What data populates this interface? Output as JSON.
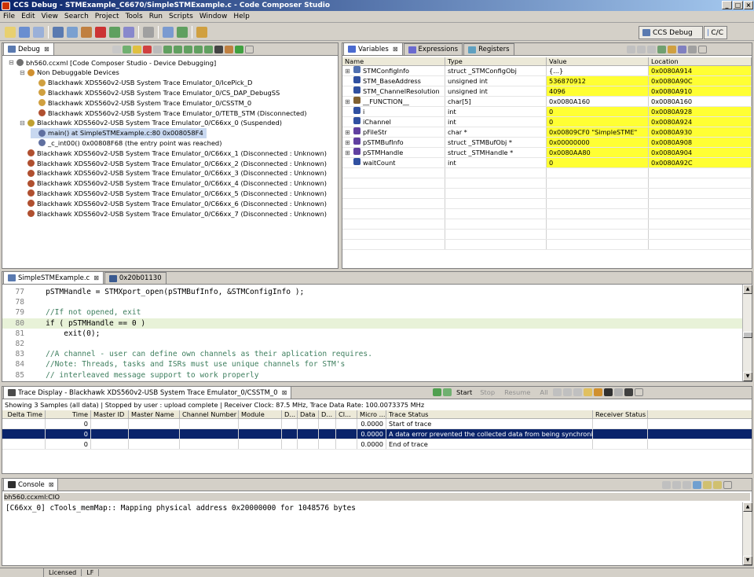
{
  "window": {
    "title": "CCS Debug - STMExample_C6670/SimpleSTMExample.c - Code Composer Studio"
  },
  "menu": [
    "File",
    "Edit",
    "View",
    "Search",
    "Project",
    "Tools",
    "Run",
    "Scripts",
    "Window",
    "Help"
  ],
  "perspective": {
    "active": "CCS Debug",
    "other": "C/C"
  },
  "debug": {
    "tab": "Debug",
    "tree": [
      {
        "indent": 0,
        "icon": "target-config-icon",
        "label": "bh560.ccxml [Code Composer Studio - Device Debugging]",
        "sel": false
      },
      {
        "indent": 1,
        "icon": "devices-icon",
        "label": "Non Debuggable Devices",
        "sel": false
      },
      {
        "indent": 2,
        "icon": "device-icon",
        "label": "Blackhawk XDS560v2-USB System Trace Emulator_0/IcePick_D",
        "sel": false
      },
      {
        "indent": 2,
        "icon": "device-icon",
        "label": "Blackhawk XDS560v2-USB System Trace Emulator_0/CS_DAP_DebugSS",
        "sel": false
      },
      {
        "indent": 2,
        "icon": "device-icon",
        "label": "Blackhawk XDS560v2-USB System Trace Emulator_0/CSSTM_0",
        "sel": false
      },
      {
        "indent": 2,
        "icon": "disconnected-icon",
        "label": "Blackhawk XDS560v2-USB System Trace Emulator_0/TETB_STM  (Disconnected)",
        "sel": false
      },
      {
        "indent": 1,
        "icon": "suspended-core-icon",
        "label": "Blackhawk XDS560v2-USB System Trace Emulator_0/C66xx_0 (Suspended)",
        "sel": false
      },
      {
        "indent": 2,
        "icon": "stack-frame-icon",
        "label": "main() at SimpleSTMExample.c:80 0x008058F4",
        "sel": true
      },
      {
        "indent": 2,
        "icon": "stack-frame-icon",
        "label": "_c_int00() 0x00808F68  (the entry point was reached)",
        "sel": false
      },
      {
        "indent": 1,
        "icon": "disconnected-icon",
        "label": "Blackhawk XDS560v2-USB System Trace Emulator_0/C66xx_1 (Disconnected : Unknown)",
        "sel": false
      },
      {
        "indent": 1,
        "icon": "disconnected-icon",
        "label": "Blackhawk XDS560v2-USB System Trace Emulator_0/C66xx_2 (Disconnected : Unknown)",
        "sel": false
      },
      {
        "indent": 1,
        "icon": "disconnected-icon",
        "label": "Blackhawk XDS560v2-USB System Trace Emulator_0/C66xx_3 (Disconnected : Unknown)",
        "sel": false
      },
      {
        "indent": 1,
        "icon": "disconnected-icon",
        "label": "Blackhawk XDS560v2-USB System Trace Emulator_0/C66xx_4 (Disconnected : Unknown)",
        "sel": false
      },
      {
        "indent": 1,
        "icon": "disconnected-icon",
        "label": "Blackhawk XDS560v2-USB System Trace Emulator_0/C66xx_5 (Disconnected : Unknown)",
        "sel": false
      },
      {
        "indent": 1,
        "icon": "disconnected-icon",
        "label": "Blackhawk XDS560v2-USB System Trace Emulator_0/C66xx_6 (Disconnected : Unknown)",
        "sel": false
      },
      {
        "indent": 1,
        "icon": "disconnected-icon",
        "label": "Blackhawk XDS560v2-USB System Trace Emulator_0/C66xx_7 (Disconnected : Unknown)",
        "sel": false
      }
    ]
  },
  "variables": {
    "tabs": [
      "Variables",
      "Expressions",
      "Registers"
    ],
    "columns": [
      "Name",
      "Type",
      "Value",
      "Location"
    ],
    "rows": [
      {
        "expand": "+",
        "icon": "struct-icon",
        "name": "STMConfigInfo",
        "type": "struct _STMConfigObj",
        "value": "{...}",
        "location": "0x0080A914",
        "yv": false,
        "yl": true
      },
      {
        "expand": "",
        "icon": "variable-icon",
        "name": "STM_BaseAddress",
        "type": "unsigned int",
        "value": "536870912",
        "location": "0x0080A90C",
        "yv": true,
        "yl": true
      },
      {
        "expand": "",
        "icon": "variable-icon",
        "name": "STM_ChannelResolution",
        "type": "unsigned int",
        "value": "4096",
        "location": "0x0080A910",
        "yv": true,
        "yl": true
      },
      {
        "expand": "+",
        "icon": "array-icon",
        "name": "__FUNCTION__",
        "type": "char[5]",
        "value": "0x0080A160",
        "location": "0x0080A160",
        "yv": false,
        "yl": false
      },
      {
        "expand": "",
        "icon": "variable-icon",
        "name": "i",
        "type": "int",
        "value": "0",
        "location": "0x0080A928",
        "yv": true,
        "yl": true
      },
      {
        "expand": "",
        "icon": "variable-icon",
        "name": "iChannel",
        "type": "int",
        "value": "0",
        "location": "0x0080A924",
        "yv": true,
        "yl": true
      },
      {
        "expand": "+",
        "icon": "pointer-icon",
        "name": "pFileStr",
        "type": "char *",
        "value": "0x00809CF0 \"SimpleSTME\"",
        "location": "0x0080A930",
        "yv": true,
        "yl": true
      },
      {
        "expand": "+",
        "icon": "pointer-icon",
        "name": "pSTMBufInfo",
        "type": "struct _STMBufObj *",
        "value": "0x00000000",
        "location": "0x0080A908",
        "yv": true,
        "yl": true
      },
      {
        "expand": "+",
        "icon": "pointer-icon",
        "name": "pSTMHandle",
        "type": "struct _STMHandle *",
        "value": "0x0080AA80",
        "location": "0x0080A904",
        "yv": true,
        "yl": true
      },
      {
        "expand": "",
        "icon": "variable-icon",
        "name": "waitCount",
        "type": "int",
        "value": "0",
        "location": "0x0080A92C",
        "yv": true,
        "yl": true
      }
    ]
  },
  "editor": {
    "tabs": [
      "SimpleSTMExample.c",
      "0x20b01130"
    ],
    "lines": [
      {
        "n": "77",
        "text": "    pSTMHandle = STMXport_open(pSTMBufInfo, &STMConfigInfo );",
        "kind": "code",
        "hl": false
      },
      {
        "n": "78",
        "text": "",
        "kind": "code",
        "hl": false
      },
      {
        "n": "79",
        "text": "    //If not opened, exit",
        "kind": "cmt",
        "hl": false
      },
      {
        "n": "80",
        "text": "    if ( pSTMHandle == 0 )",
        "kind": "code",
        "hl": true
      },
      {
        "n": "81",
        "text": "        exit(0);",
        "kind": "code",
        "hl": false
      },
      {
        "n": "82",
        "text": "",
        "kind": "code",
        "hl": false
      },
      {
        "n": "83",
        "text": "    //A channel - user can define own channels as their aplication requires.",
        "kind": "cmt",
        "hl": false
      },
      {
        "n": "84",
        "text": "    //Note: Threads, tasks and ISRs must use unique channels for STM's",
        "kind": "cmt",
        "hl": false
      },
      {
        "n": "85",
        "text": "    // interleaved message support to work properly",
        "kind": "cmt",
        "hl": false
      }
    ]
  },
  "trace": {
    "tab": "Trace Display - Blackhawk XDS560v2-USB System Trace Emulator_0/CSSTM_0",
    "toolbar": {
      "start": "Start",
      "stop": "Stop",
      "resume": "Resume",
      "all": "All"
    },
    "status": "Showing 3 Samples (all data)  |  Stopped by user : upload complete  |  Receiver Clock: 87.5 MHz, Trace Data Rate: 100.0073375 MHz",
    "columns": [
      "Delta Time",
      "Time",
      "Master ID",
      "Master Name",
      "Channel Number",
      "Module",
      "D...",
      "Data",
      "D...",
      "Cl...",
      "Micro ...",
      "Trace Status",
      "Receiver Status"
    ],
    "rows": [
      {
        "cells": [
          "",
          "0",
          "",
          "",
          "",
          "",
          "",
          "",
          "",
          "",
          "0.0000",
          "Start of trace",
          ""
        ],
        "sel": false
      },
      {
        "cells": [
          "",
          "0",
          "",
          "",
          "",
          "",
          "",
          "",
          "",
          "",
          "0.0000",
          "A data error prevented the collected data from being synchronized.",
          ""
        ],
        "sel": true
      },
      {
        "cells": [
          "",
          "0",
          "",
          "",
          "",
          "",
          "",
          "",
          "",
          "",
          "0.0000",
          "End of trace",
          ""
        ],
        "sel": false
      }
    ]
  },
  "console": {
    "tab": "Console",
    "subtitle": "bh560.ccxml:CIO",
    "text": "[C66xx_0] cTools_memMap:: Mapping physical address 0x20000000 for 1048576 bytes"
  },
  "statusbar": {
    "license": "Licensed",
    "mode": "LF"
  }
}
